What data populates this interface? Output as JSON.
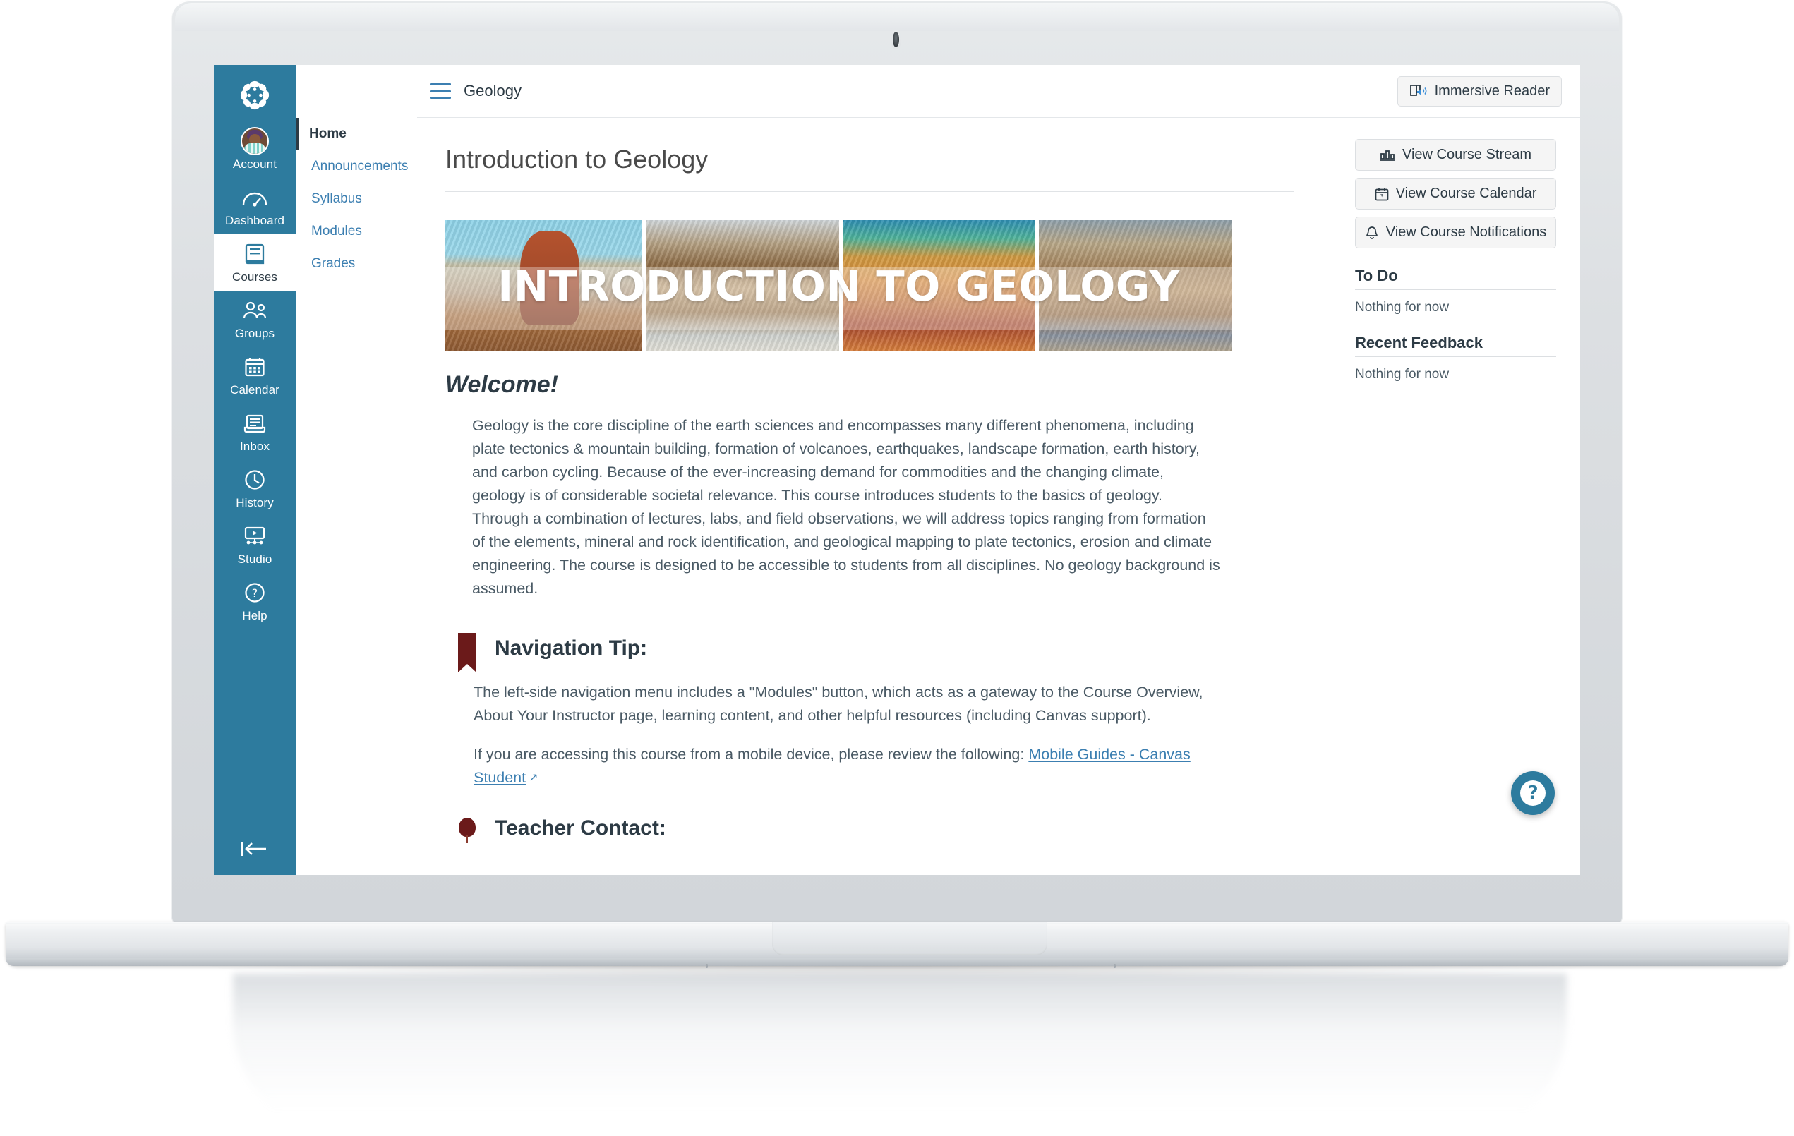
{
  "global_nav": {
    "logo_name": "canvas-logo",
    "items": [
      {
        "label": "Account",
        "icon": "avatar-icon",
        "active": false
      },
      {
        "label": "Dashboard",
        "icon": "dashboard-icon",
        "active": false
      },
      {
        "label": "Courses",
        "icon": "courses-book-icon",
        "active": true
      },
      {
        "label": "Groups",
        "icon": "groups-people-icon",
        "active": false
      },
      {
        "label": "Calendar",
        "icon": "calendar-icon",
        "active": false
      },
      {
        "label": "Inbox",
        "icon": "inbox-envelope-icon",
        "active": false
      },
      {
        "label": "History",
        "icon": "clock-icon",
        "active": false
      },
      {
        "label": "Studio",
        "icon": "studio-screen-icon",
        "active": false
      },
      {
        "label": "Help",
        "icon": "question-circle-icon",
        "active": false
      }
    ],
    "collapse_icon": "collapse-left-arrow-icon"
  },
  "topbar": {
    "menu_icon": "hamburger-menu-icon",
    "breadcrumb": "Geology",
    "immersive_reader": {
      "label": "Immersive Reader",
      "icon": "immersive-reader-book-icon"
    }
  },
  "course_nav": {
    "items": [
      {
        "label": "Home",
        "current": true
      },
      {
        "label": "Announcements",
        "current": false
      },
      {
        "label": "Syllabus",
        "current": false
      },
      {
        "label": "Modules",
        "current": false
      },
      {
        "label": "Grades",
        "current": false
      }
    ]
  },
  "page": {
    "title": "Introduction to Geology",
    "banner_text": "INTRODUCTION TO GEOLOGY",
    "welcome_heading": "Welcome!",
    "intro_paragraph": "Geology is the core discipline of the earth sciences and encompasses many different phenomena, including plate tectonics & mountain building, formation of volcanoes, earthquakes, landscape formation, earth history, and carbon cycling. Because of the ever-increasing demand for commodities and the changing climate, geology is of considerable societal relevance. This course introduces students to the basics of geology. Through a combination of lectures, labs, and field observations, we will address topics ranging from formation of the elements, mineral and rock identification, and geological mapping to plate tectonics, erosion and climate engineering. The course is designed to be accessible to students from all disciplines. No geology background is assumed.",
    "nav_tip_heading": "Navigation Tip:",
    "nav_tip_p1": "The left-side navigation menu includes a \"Modules\" button, which acts as a gateway to the Course Overview, About Your Instructor page, learning content, and other helpful resources (including Canvas support).",
    "nav_tip_p2_prefix": "If you are accessing this course from a mobile device, please review the following: ",
    "nav_tip_link": "Mobile Guides - Canvas Student",
    "external_link_icon": "external-link-icon",
    "teacher_contact_heading": "Teacher Contact:"
  },
  "rail": {
    "buttons": [
      {
        "label": "View Course Stream",
        "icon": "bar-chart-icon"
      },
      {
        "label": "View Course Calendar",
        "icon": "calendar-day-icon"
      },
      {
        "label": "View Course Notifications",
        "icon": "bell-icon"
      }
    ],
    "todo_heading": "To Do",
    "todo_empty": "Nothing for now",
    "feedback_heading": "Recent Feedback",
    "feedback_empty": "Nothing for now"
  },
  "help_fab": {
    "glyph": "?",
    "name": "help-fab"
  },
  "colors": {
    "brand_teal": "#2d7b9e",
    "link_blue": "#3c7fb1",
    "text_dark": "#2d3b45",
    "accent_maroon": "#6b1a1a"
  }
}
